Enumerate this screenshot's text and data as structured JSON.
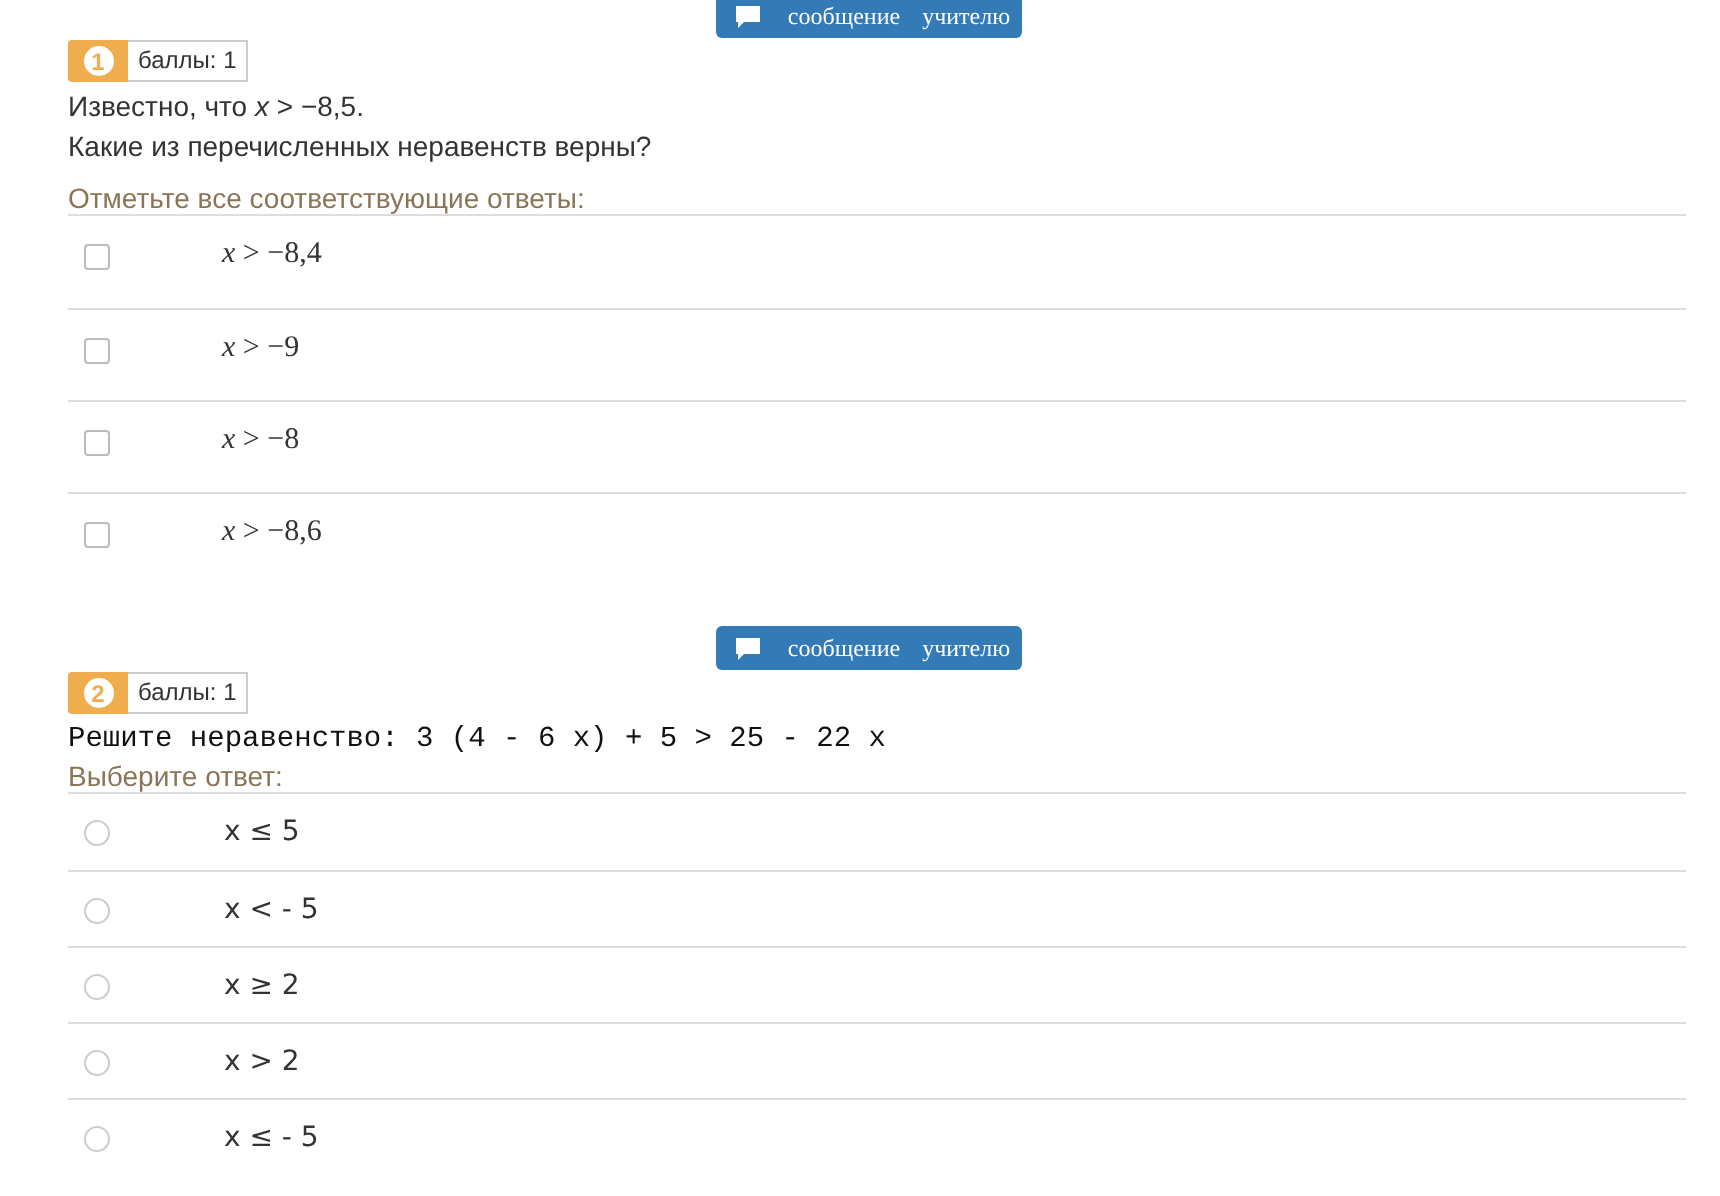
{
  "questions": [
    {
      "message_button": "сообщение учителю",
      "number": "1",
      "points": "баллы: 1",
      "kind": "multiple",
      "text": [
        "Известно, что *x* > −8,5.",
        "Какие из перечисленных неравенств верны?"
      ],
      "prompt": "Отметьте все соответствующие ответы:",
      "options": [
        {
          "text": "*x* > −8,4",
          "selected": false
        },
        {
          "text": "*x* > −9",
          "selected": false
        },
        {
          "text": "*x* > −8",
          "selected": false
        },
        {
          "text": "*x* > −8,6",
          "selected": false
        }
      ]
    },
    {
      "message_button": "сообщение учителю",
      "number": "2",
      "points": "баллы: 1",
      "kind": "single",
      "text": [
        "Решите неравенство: 3 (4 - 6 x) + 5 > 25 - 22 x"
      ],
      "prompt": "Выберите ответ:",
      "options": [
        {
          "text": "x ≤ 5",
          "selected": false
        },
        {
          "text": "x < - 5",
          "selected": false
        },
        {
          "text": "x ≥ 2",
          "selected": false
        },
        {
          "text": "x > 2",
          "selected": false
        },
        {
          "text": "x ≤ - 5",
          "selected": false
        }
      ]
    }
  ]
}
